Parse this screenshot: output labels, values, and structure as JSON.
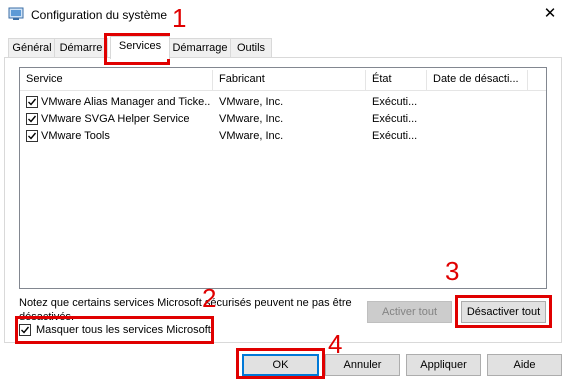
{
  "window": {
    "title": "Configuration du système",
    "close_symbol": "✕"
  },
  "tabs": [
    {
      "label": "Général"
    },
    {
      "label": "Démarre"
    },
    {
      "label": "Services"
    },
    {
      "label": "Démarrage"
    },
    {
      "label": "Outils"
    }
  ],
  "table": {
    "columns": [
      "Service",
      "Fabricant",
      "État",
      "Date de désacti..."
    ],
    "rows": [
      {
        "checked": true,
        "service": "VMware Alias Manager and Ticke...",
        "vendor": "VMware, Inc.",
        "state": "Exécuti...",
        "date": ""
      },
      {
        "checked": true,
        "service": "VMware SVGA Helper Service",
        "vendor": "VMware, Inc.",
        "state": "Exécuti...",
        "date": ""
      },
      {
        "checked": true,
        "service": "VMware Tools",
        "vendor": "VMware, Inc.",
        "state": "Exécuti...",
        "date": ""
      }
    ]
  },
  "notice": "Notez que certains services Microsoft sécurisés peuvent ne pas être désactivés.",
  "hide_ms": {
    "label": "Masquer tous les services Microsoft",
    "checked": true
  },
  "buttons": {
    "enable_all": "Activer tout",
    "disable_all": "Désactiver tout",
    "ok": "OK",
    "cancel": "Annuler",
    "apply": "Appliquer",
    "help": "Aide"
  },
  "annotations": [
    "1",
    "2",
    "3",
    "4"
  ],
  "colors": {
    "annotation": "#e00000",
    "focus": "#0078d7"
  }
}
